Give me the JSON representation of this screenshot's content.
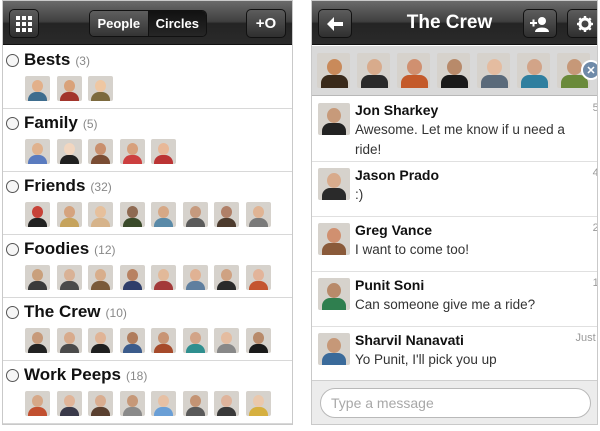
{
  "left": {
    "tabs": [
      {
        "label": "People",
        "active": false
      },
      {
        "label": "Circles",
        "active": true
      }
    ],
    "grid_icon": "grid-icon",
    "add_circle_icon": "add-circle-icon",
    "add_circle_label": "+O",
    "circles": [
      {
        "name": "Bests",
        "count": "(3)",
        "avatars": [
          [
            "#e2b08a",
            "#3e6d8e"
          ],
          [
            "#d9a27a",
            "#a2352c"
          ],
          [
            "#efc7a2",
            "#7c6a3e"
          ]
        ]
      },
      {
        "name": "Family",
        "count": "(5)",
        "avatars": [
          [
            "#e0b28e",
            "#5a7bbf"
          ],
          [
            "#f1d6c0",
            "#202020"
          ],
          [
            "#c98f6d",
            "#7a4d34"
          ],
          [
            "#d7a07c",
            "#cc3f3f"
          ],
          [
            "#e8b898",
            "#bb3434"
          ]
        ]
      },
      {
        "name": "Friends",
        "count": "(32)",
        "avatars": [
          [
            "#c74238",
            "#222222"
          ],
          [
            "#d5a37e",
            "#c6a35c"
          ],
          [
            "#e6c09c",
            "#d6b38a"
          ],
          [
            "#8f6a52",
            "#3a4a2a"
          ],
          [
            "#d6a886",
            "#5a8aa8"
          ],
          [
            "#c69a7e",
            "#5b5b5b"
          ],
          [
            "#b08068",
            "#4d3b2e"
          ],
          [
            "#e0b494",
            "#7a7a7a"
          ]
        ]
      },
      {
        "name": "Foodies",
        "count": "(12)",
        "avatars": [
          [
            "#c9a07c",
            "#3b3b3b"
          ],
          [
            "#d9b296",
            "#4b4b4b"
          ],
          [
            "#d8ae8c",
            "#7a5a3a"
          ],
          [
            "#b88262",
            "#2f3e6a"
          ],
          [
            "#e2b999",
            "#a33a3a"
          ],
          [
            "#e0b294",
            "#5f7f9f"
          ],
          [
            "#cfa282",
            "#2a2a2a"
          ],
          [
            "#e2b49a",
            "#c45530"
          ]
        ]
      },
      {
        "name": "The Crew",
        "count": "(10)",
        "avatars": [
          [
            "#c79a7a",
            "#222222"
          ],
          [
            "#d8ab8c",
            "#4b4b4b"
          ],
          [
            "#e0b496",
            "#1f1f1f"
          ],
          [
            "#b07c5c",
            "#3b5b8b"
          ],
          [
            "#c89474",
            "#a64a2a"
          ],
          [
            "#d2a488",
            "#2f8f8f"
          ],
          [
            "#e4bca0",
            "#888888"
          ],
          [
            "#b88a6a",
            "#1a1a1a"
          ]
        ]
      },
      {
        "name": "Work Peeps",
        "count": "(18)",
        "avatars": [
          [
            "#d6a888",
            "#c25030"
          ],
          [
            "#e0b498",
            "#3a3a4a"
          ],
          [
            "#d9ad90",
            "#5a4030"
          ],
          [
            "#c69878",
            "#8a8a8a"
          ],
          [
            "#e6c0a4",
            "#6a9fd6"
          ],
          [
            "#c49474",
            "#5a5a5a"
          ],
          [
            "#dfb49c",
            "#3a3a3a"
          ],
          [
            "#eac8ac",
            "#d6b040"
          ]
        ]
      }
    ]
  },
  "right": {
    "back_icon": "back-arrow-icon",
    "title": "The Crew",
    "add_person_icon": "add-person-icon",
    "settings_icon": "gear-icon",
    "strip_avatars": [
      [
        "#c98a5a",
        "#3a2a1a"
      ],
      [
        "#d8ab8c",
        "#2a2a2a"
      ],
      [
        "#d09070",
        "#c45a2a"
      ],
      [
        "#b88a6a",
        "#1a1a1a"
      ],
      [
        "#e4bca0",
        "#5a6a7a"
      ],
      [
        "#d2a488",
        "#2f7f9f"
      ],
      [
        "#c69878",
        "#6a8a3a"
      ]
    ],
    "strip_close_icon": "close-icon",
    "messages": [
      {
        "name": "Jon Sharkey",
        "text": "Awesome. Let me know if u need a ride!",
        "time": "5 m",
        "avatar": [
          "#c79a7a",
          "#222222"
        ]
      },
      {
        "name": "Jason Prado",
        "text": ":)",
        "time": "4 m",
        "avatar": [
          "#d8ab8c",
          "#2a2a2a"
        ]
      },
      {
        "name": "Greg Vance",
        "text": "I want to come too!",
        "time": "2 m",
        "avatar": [
          "#d09070",
          "#8a5a3a"
        ]
      },
      {
        "name": "Punit Soni",
        "text": "Can someone give me a ride?",
        "time": "1 m",
        "avatar": [
          "#b88a6a",
          "#2f7f4f"
        ]
      },
      {
        "name": "Sharvil Nanavati",
        "text": "Yo Punit, I'll pick you up",
        "time": "Just no",
        "avatar": [
          "#c69878",
          "#3a6a9a"
        ]
      }
    ],
    "composer_placeholder": "Type a message"
  }
}
